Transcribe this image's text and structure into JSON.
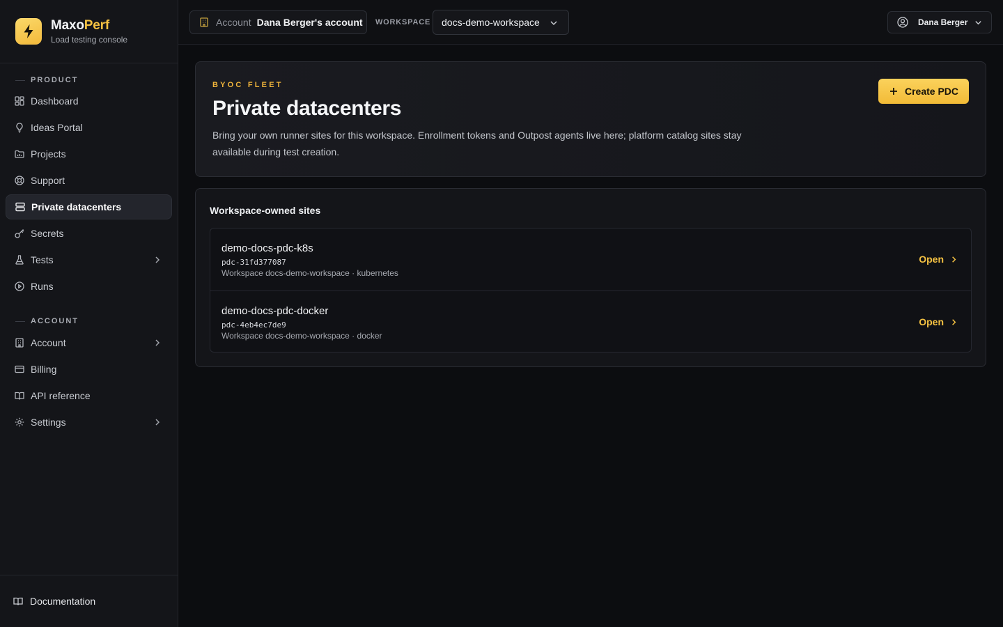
{
  "brand": {
    "name_part1": "Maxo",
    "name_part2": "Perf",
    "subtitle": "Load testing console",
    "accent_color": "#f5c242"
  },
  "sidebar": {
    "sections": [
      {
        "label": "PRODUCT",
        "items": [
          {
            "label": "Dashboard",
            "icon": "dashboard-icon"
          },
          {
            "label": "Ideas Portal",
            "icon": "lightbulb-icon"
          },
          {
            "label": "Projects",
            "icon": "folder-icon"
          },
          {
            "label": "Support",
            "icon": "lifebuoy-icon"
          },
          {
            "label": "Private datacenters",
            "icon": "server-icon",
            "active": true
          },
          {
            "label": "Secrets",
            "icon": "key-icon"
          },
          {
            "label": "Tests",
            "icon": "flask-icon",
            "expandable": true
          },
          {
            "label": "Runs",
            "icon": "play-circle-icon"
          }
        ]
      },
      {
        "label": "ACCOUNT",
        "items": [
          {
            "label": "Account",
            "icon": "building-icon",
            "expandable": true
          },
          {
            "label": "Billing",
            "icon": "credit-card-icon"
          },
          {
            "label": "API reference",
            "icon": "book-icon"
          },
          {
            "label": "Settings",
            "icon": "gear-icon",
            "expandable": true
          }
        ]
      }
    ],
    "footer_label": "Documentation"
  },
  "topbar": {
    "account_key": "Account",
    "account_value": "Dana Berger's account",
    "workspace_label": "WORKSPACE",
    "workspace_value": "docs-demo-workspace",
    "user_name": "Dana Berger"
  },
  "hero": {
    "eyebrow": "BYOC FLEET",
    "title": "Private datacenters",
    "description": "Bring your own runner sites for this workspace. Enrollment tokens and Outpost agents live here; platform catalog sites stay available during test creation.",
    "create_label": "Create PDC"
  },
  "sites": {
    "title": "Workspace-owned sites",
    "open_label": "Open",
    "rows": [
      {
        "name": "demo-docs-pdc-k8s",
        "id": "pdc-31fd377087",
        "meta": "Workspace docs-demo-workspace · kubernetes"
      },
      {
        "name": "demo-docs-pdc-docker",
        "id": "pdc-4eb4ec7de9",
        "meta": "Workspace docs-demo-workspace · docker"
      }
    ]
  }
}
